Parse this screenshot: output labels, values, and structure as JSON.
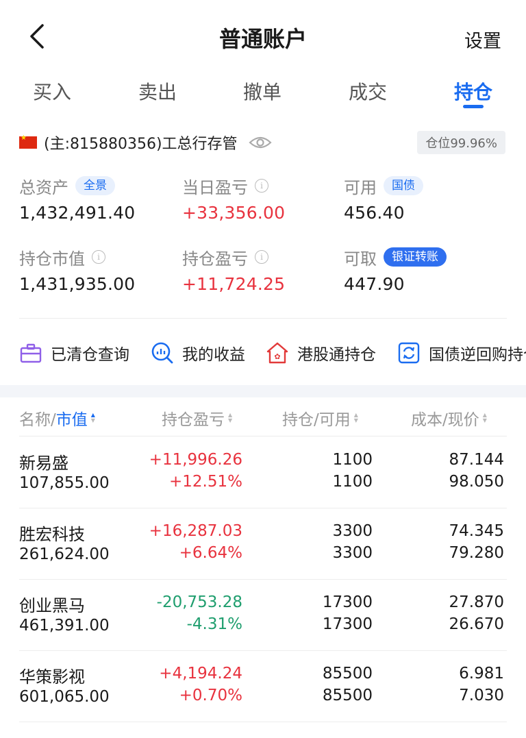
{
  "header": {
    "title": "普通账户",
    "settings": "设置"
  },
  "tabs": [
    "买入",
    "卖出",
    "撤单",
    "成交",
    "持仓"
  ],
  "account": {
    "text": "(主:815880356)工总行存管",
    "position_badge": "仓位99.96%"
  },
  "summary": {
    "total_assets": {
      "label": "总资产",
      "pill": "全景",
      "value": "1,432,491.40"
    },
    "daily_pl": {
      "label": "当日盈亏",
      "value": "+33,356.00"
    },
    "available": {
      "label": "可用",
      "pill": "国债",
      "value": "456.40"
    },
    "market_value": {
      "label": "持仓市值",
      "value": "1,431,935.00"
    },
    "position_pl": {
      "label": "持仓盈亏",
      "value": "+11,724.25"
    },
    "withdrawable": {
      "label": "可取",
      "pill": "银证转账",
      "value": "447.90"
    }
  },
  "actions": [
    "已清仓查询",
    "我的收益",
    "港股通持仓",
    "国债逆回购持仓"
  ],
  "table": {
    "headers": {
      "name_a": "名称/",
      "name_b": "市值",
      "pl": "持仓盈亏",
      "qty": "持仓/可用",
      "cost": "成本/现价"
    },
    "rows": [
      {
        "name": "新易盛",
        "market_value": "107,855.00",
        "pl_amount": "+11,996.26",
        "pl_pct": "+12.51%",
        "qty": "1100",
        "avail": "1100",
        "cost": "87.144",
        "price": "98.050",
        "trend": "up"
      },
      {
        "name": "胜宏科技",
        "market_value": "261,624.00",
        "pl_amount": "+16,287.03",
        "pl_pct": "+6.64%",
        "qty": "3300",
        "avail": "3300",
        "cost": "74.345",
        "price": "79.280",
        "trend": "up"
      },
      {
        "name": "创业黑马",
        "market_value": "461,391.00",
        "pl_amount": "-20,753.28",
        "pl_pct": "-4.31%",
        "qty": "17300",
        "avail": "17300",
        "cost": "27.870",
        "price": "26.670",
        "trend": "down"
      },
      {
        "name": "华策影视",
        "market_value": "601,065.00",
        "pl_amount": "+4,194.24",
        "pl_pct": "+0.70%",
        "qty": "85500",
        "avail": "85500",
        "cost": "6.981",
        "price": "7.030",
        "trend": "up"
      }
    ]
  },
  "colors": {
    "accent": "#1a6cf0",
    "up": "#e8323e",
    "down": "#1f9e6e"
  }
}
